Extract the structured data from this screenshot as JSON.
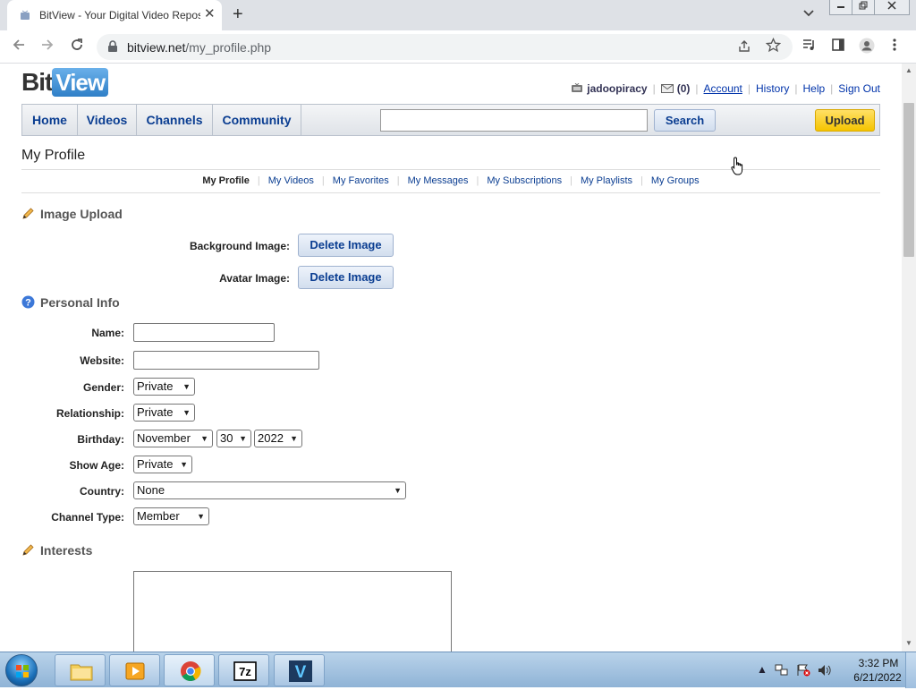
{
  "browser": {
    "tab_title": "BitView - Your Digital Video Repository",
    "tab_close": "✕",
    "new_tab": "+",
    "url_host": "bitview.net",
    "url_path": "/my_profile.php"
  },
  "site": {
    "logo_bit": "Bit",
    "logo_view": "View",
    "userbar": {
      "username": "jadoopiracy",
      "message_count": "(0)",
      "links": [
        "Account",
        "History",
        "Help",
        "Sign Out"
      ]
    },
    "nav": [
      "Home",
      "Videos",
      "Channels",
      "Community"
    ],
    "search_label": "Search",
    "search_value": "",
    "upload_label": "Upload"
  },
  "page": {
    "title": "My Profile",
    "subnav": [
      "My Profile",
      "My Videos",
      "My Favorites",
      "My Messages",
      "My Subscriptions",
      "My Playlists",
      "My Groups"
    ],
    "active_subnav": "My Profile"
  },
  "image_upload": {
    "heading": "Image Upload",
    "background_label": "Background Image:",
    "avatar_label": "Avatar Image:",
    "delete_label": "Delete Image"
  },
  "personal_info": {
    "heading": "Personal Info",
    "fields": {
      "name": {
        "label": "Name:",
        "value": ""
      },
      "website": {
        "label": "Website:",
        "value": ""
      },
      "gender": {
        "label": "Gender:",
        "value": "Private"
      },
      "relationship": {
        "label": "Relationship:",
        "value": "Private"
      },
      "birthday": {
        "label": "Birthday:",
        "month": "November",
        "day": "30",
        "year": "2022"
      },
      "show_age": {
        "label": "Show Age:",
        "value": "Private"
      },
      "country": {
        "label": "Country:",
        "value": "None"
      },
      "channel_type": {
        "label": "Channel Type:",
        "value": "Member"
      }
    }
  },
  "interests": {
    "heading": "Interests",
    "value": ""
  },
  "taskbar": {
    "time": "3:32 PM",
    "date": "6/21/2022",
    "apps": [
      "file-explorer",
      "media-player",
      "chrome",
      "7-zip",
      "veracrypt"
    ]
  },
  "colors": {
    "link_blue": "#0a3d91",
    "upload_yellow": "#f5c400",
    "logo_blue": "#2f7fc7"
  }
}
